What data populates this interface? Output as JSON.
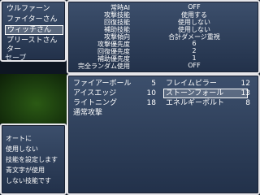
{
  "party": {
    "members": [
      "ウルファーン",
      "ファイターさん",
      "ウィッチさん",
      "プリーストさん",
      "ター"
    ],
    "selected_index": 2,
    "save_label": "セーブ"
  },
  "settings": {
    "rows": [
      {
        "label": "常時AI",
        "value": "OFF"
      },
      {
        "label": "攻撃技能",
        "value": "使用する"
      },
      {
        "label": "回復技能",
        "value": "使用しない"
      },
      {
        "label": "補助技能",
        "value": "使用しない"
      },
      {
        "label": "攻撃傾向",
        "value": "合計ダメージ重視"
      },
      {
        "label": "攻撃優先度",
        "value": "6"
      },
      {
        "label": "回復優先度",
        "value": "2"
      },
      {
        "label": "補助優先度",
        "value": "1"
      },
      {
        "label": "完全ランダム使用",
        "value": "OFF"
      }
    ]
  },
  "skills": {
    "left": [
      {
        "name": "ファイアーボール",
        "cost": "5"
      },
      {
        "name": "アイスエッジ",
        "cost": "10"
      },
      {
        "name": "ライトニング",
        "cost": "18"
      },
      {
        "name": "通常攻撃",
        "cost": ""
      }
    ],
    "right": [
      {
        "name": "フレイムピラー",
        "cost": "12"
      },
      {
        "name": "ストーンフォール",
        "cost": "13"
      },
      {
        "name": "エネルギーボルト",
        "cost": "8"
      }
    ],
    "selected": "right-1"
  },
  "help": {
    "lines": [
      "オートに",
      "使用しない",
      "技能を設定します",
      "青文字が使用",
      "しない技能です"
    ]
  }
}
